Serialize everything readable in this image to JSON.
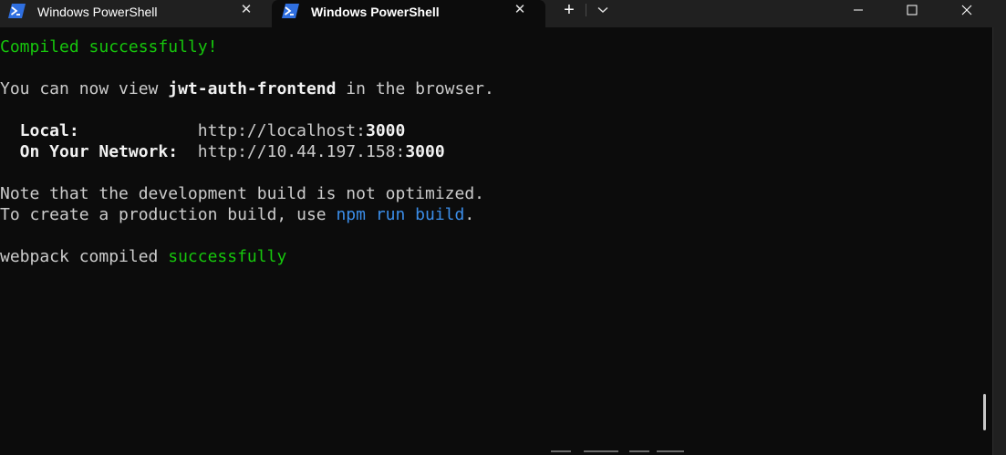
{
  "tabs": [
    {
      "title": "Windows PowerShell",
      "icon": "powershell-icon",
      "active": false
    },
    {
      "title": "Windows PowerShell",
      "icon": "powershell-icon",
      "active": true
    }
  ],
  "titlebar": {
    "new_tab_icon": "plus-icon",
    "dropdown_icon": "chevron-down-icon",
    "window_controls": [
      "minimize-icon",
      "maximize-icon",
      "close-icon"
    ]
  },
  "colors": {
    "background": "#0c0c0c",
    "text": "#cccccc",
    "success": "#16c60c",
    "command": "#3b8eea",
    "emphasis": "#f2f2f2"
  },
  "terminal": {
    "line1": "Compiled successfully!",
    "line2": {
      "pre": "You can now view ",
      "app": "jwt-auth-frontend",
      "post": " in the browser."
    },
    "local": {
      "label": "  Local:            ",
      "url_pre": "http://localhost:",
      "port": "3000"
    },
    "network": {
      "label": "  On Your Network:  ",
      "url_pre": "http://10.44.197.158:",
      "port": "3000"
    },
    "note1": "Note that the development build is not optimized.",
    "note2": {
      "pre": "To create a production build, use ",
      "cmd": "npm run build",
      "post": "."
    },
    "webpack": {
      "pre": "webpack compiled ",
      "status": "successfully"
    }
  }
}
